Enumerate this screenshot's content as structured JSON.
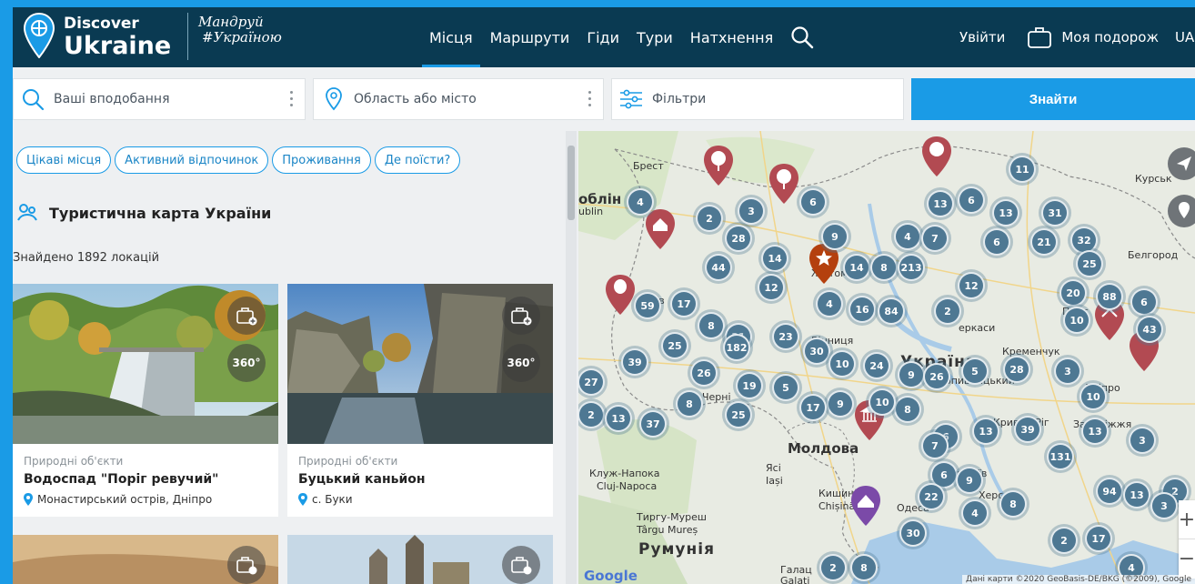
{
  "header": {
    "logo_top": "Discover",
    "logo_main": "Ukraine",
    "logo_script_line1": "Мандруй",
    "logo_script_line2": "#Україною",
    "nav": [
      "Місця",
      "Маршрути",
      "Гіди",
      "Тури",
      "Натхнення"
    ],
    "active_nav": "Місця",
    "login": "Увійти",
    "my_trip": "Моя подорож",
    "lang": "UA"
  },
  "search": {
    "preferences_placeholder": "Ваші вподобання",
    "region_placeholder": "Область або місто",
    "filters_label": "Фільтри",
    "find_button": "Знайти"
  },
  "chips": [
    "Цікаві місця",
    "Активний відпочинок",
    "Проживання",
    "Де поїсти?"
  ],
  "list": {
    "title": "Туристична карта України",
    "found": "Знайдено 1892 локацій",
    "cards": [
      {
        "category": "Природні об'єкти",
        "name": "Водоспад \"Поріг ревучий\"",
        "location": "Монастирський острів, Дніпро",
        "badge_360": "360°"
      },
      {
        "category": "Природні об'єкти",
        "name": "Буцький каньйон",
        "location": "с. Буки",
        "badge_360": "360°"
      }
    ]
  },
  "map": {
    "labels": {
      "brest": "Брест",
      "lublin1": "облін",
      "lublin2": "ublin",
      "kursk": "Курськ",
      "belgorod": "Белгород",
      "zhytomyr": "Житом",
      "cherkasy": "еркаси",
      "vinnytsia": "Вінниця",
      "kremenchuk": "Кременчук",
      "ukraine": "Україна",
      "kropyvnytskyi": "ропивницький",
      "kryvyi_rih": "Кривий Ріг",
      "zaporizhzhia": "Запоріжжя",
      "dnipro": "Дніпро",
      "poltava": "Полтава",
      "kharkiv": "Харків",
      "moldova": "Молдова",
      "cluj_ru": "Клуж-Напока",
      "cluj": "Cluj-Napoca",
      "iasi_ru": "Ясі",
      "iasi": "Iași",
      "chisinau": "Кишинів",
      "chisinau2": "Chișinău",
      "odesa": "Одеса",
      "mykolaiv": "Миколаїв",
      "kherson": "Херсон",
      "targu_ru": "Тиргу-Муреш",
      "targu": "Târgu Mureș",
      "romania": "Румунія",
      "galati_ru": "Галац",
      "galati": "Galați",
      "cherni": "Черні",
      "lviv": "Львів",
      "poltava_short": "Полт"
    },
    "clusters": [
      "11",
      "4",
      "6",
      "13",
      "6",
      "13",
      "31",
      "2",
      "3",
      "28",
      "4",
      "7",
      "6",
      "21",
      "32",
      "44",
      "14",
      "9",
      "14",
      "8",
      "213",
      "25",
      "12",
      "12",
      "59",
      "17",
      "8",
      "20",
      "4",
      "16",
      "84",
      "2",
      "10",
      "88",
      "6",
      "23",
      "43",
      "39",
      "25",
      "21",
      "26",
      "182",
      "30",
      "10",
      "24",
      "9",
      "26",
      "5",
      "28",
      "3",
      "10",
      "27",
      "19",
      "5",
      "9",
      "2",
      "13",
      "8",
      "37",
      "25",
      "17",
      "8",
      "6",
      "10",
      "39",
      "13",
      "13",
      "131",
      "3",
      "7",
      "6",
      "9",
      "8",
      "22",
      "2",
      "30",
      "4",
      "2",
      "17",
      "94",
      "13",
      "3",
      "2",
      "8",
      "4"
    ],
    "google": "Google",
    "attribution": "Дані карти ©2020 GeoBasis-DE/BKG (©2009), Google",
    "zoom_in": "+",
    "zoom_out": "−"
  }
}
